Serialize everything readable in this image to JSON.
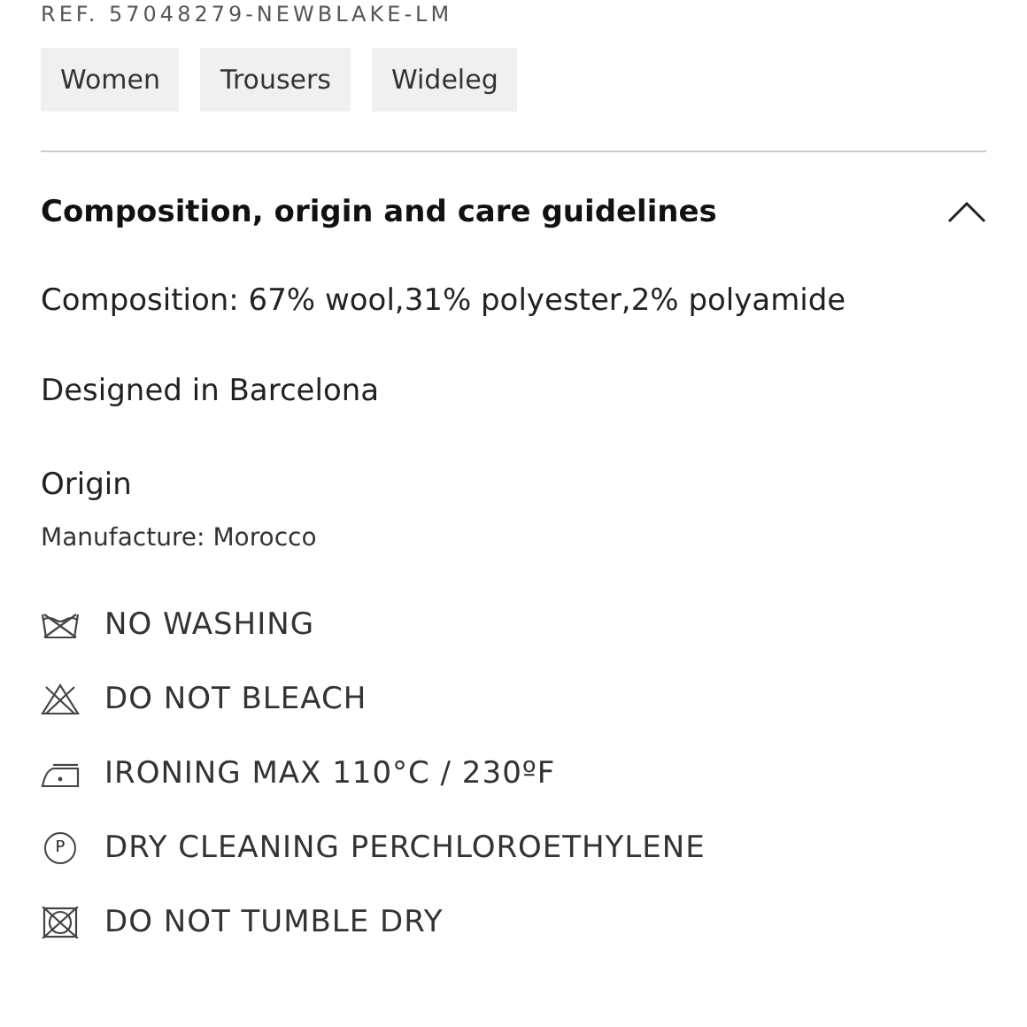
{
  "reference": "REF. 57048279-NEWBLAKE-LM",
  "tags": [
    "Women",
    "Trousers",
    "Wideleg"
  ],
  "section": {
    "title": "Composition, origin and care guidelines",
    "expanded": true,
    "composition": "Composition: 67% wool,31% polyester,2% polyamide",
    "designed": "Designed in Barcelona",
    "origin_label": "Origin",
    "manufacture": "Manufacture: Morocco",
    "care": [
      {
        "kind": "no-wash",
        "text": "NO WASHING"
      },
      {
        "kind": "no-bleach",
        "text": "DO NOT BLEACH"
      },
      {
        "kind": "iron",
        "text": "IRONING MAX 110°C / 230ºF"
      },
      {
        "kind": "dry-clean",
        "symbol": "P",
        "text": "DRY CLEANING PERCHLOROETHYLENE"
      },
      {
        "kind": "no-tumble",
        "text": "DO NOT TUMBLE DRY"
      }
    ]
  }
}
